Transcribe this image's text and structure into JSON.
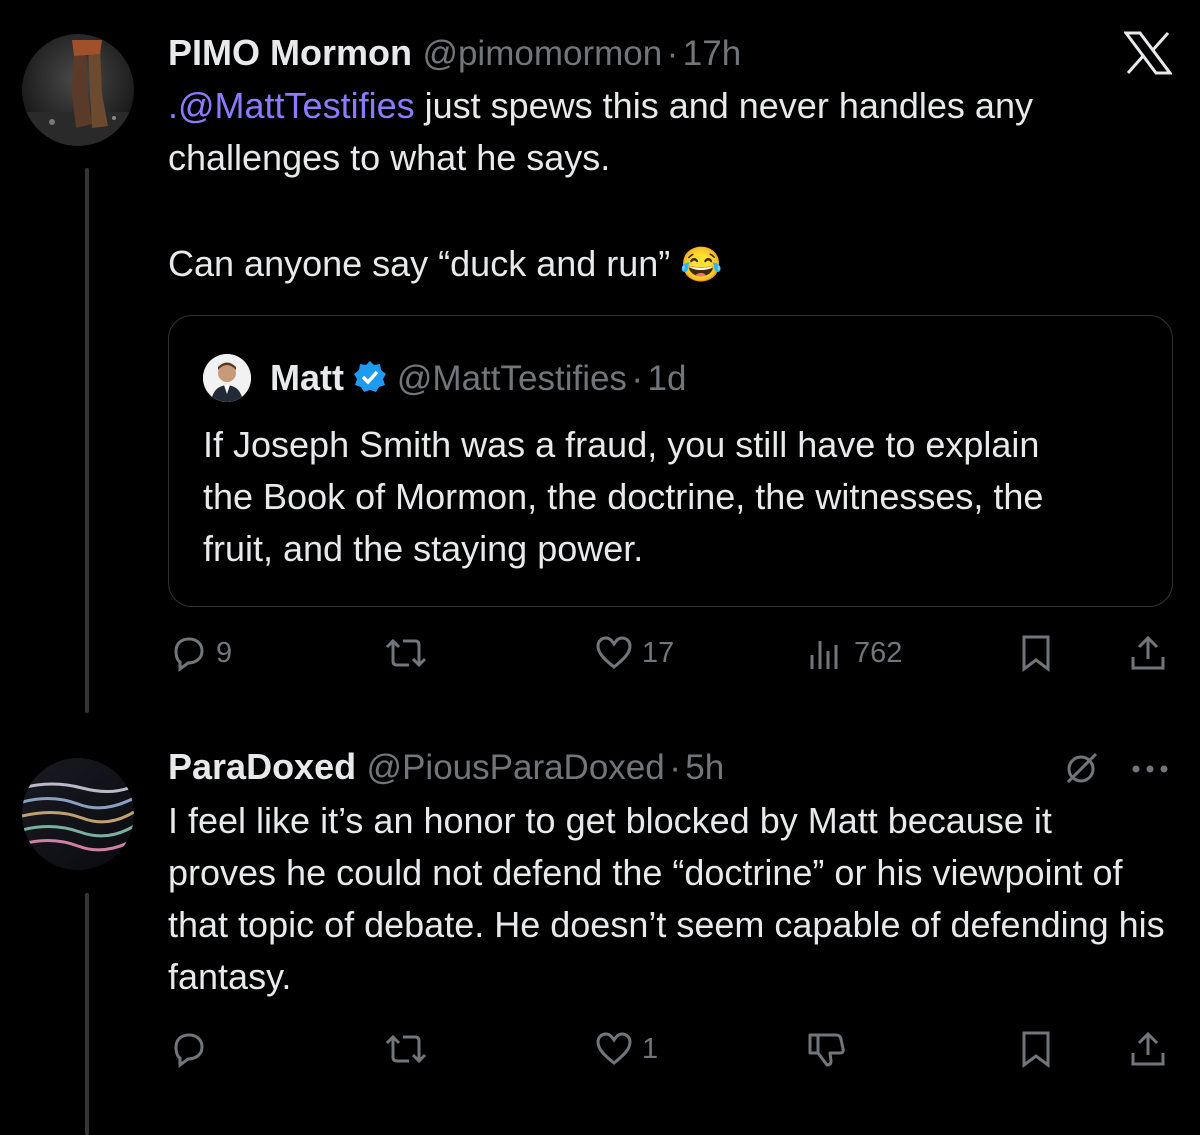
{
  "tweets": [
    {
      "display_name": "PIMO Mormon",
      "handle": "@pimomormon",
      "separator": "·",
      "time": "17h",
      "mention": ".@MattTestifies",
      "text_line1_rest": " just spews this and never handles any challenges to what he says.",
      "text_para2": "Can anyone say “duck and run”",
      "emoji": "😂",
      "quote": {
        "display_name": "Matt",
        "handle": "@MattTestifies",
        "separator": "·",
        "time": "1d",
        "text": "If Joseph Smith was a fraud, you still have to explain the Book of Mormon, the doctrine, the witnesses, the fruit, and the staying power."
      },
      "actions": {
        "replies": "9",
        "reposts": "",
        "likes": "17",
        "views": "762"
      }
    },
    {
      "display_name": "ParaDoxed",
      "handle": "@PiousParaDoxed",
      "separator": "·",
      "time": "5h",
      "text": "I feel like it’s an honor to get blocked by Matt because it proves he could not defend the “doctrine” or his viewpoint of that topic of debate. He doesn’t seem capable of defending his fantasy.",
      "actions": {
        "replies": "",
        "reposts": "",
        "likes": "1"
      }
    }
  ],
  "colors": {
    "background": "#000000",
    "text": "#e7e9ea",
    "muted": "#71767b",
    "mention": "#8b7cff",
    "verified": "#1d9bf0"
  },
  "icons": [
    "x-logo-icon",
    "verified-badge-icon",
    "reply-icon",
    "repost-icon",
    "like-icon",
    "views-icon",
    "bookmark-icon",
    "share-icon",
    "grok-icon",
    "more-icon",
    "dislike-icon"
  ]
}
